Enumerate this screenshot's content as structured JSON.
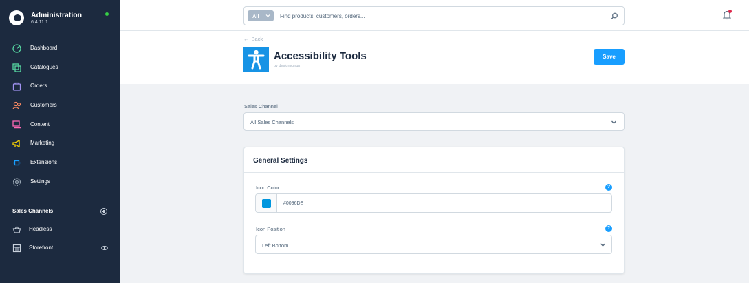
{
  "brand": {
    "title": "Administration",
    "version": "6.4.11.1"
  },
  "sidebar": {
    "items": [
      {
        "label": "Dashboard",
        "icon": "dashboard-icon",
        "color": "#57d9a3"
      },
      {
        "label": "Catalogues",
        "icon": "catalogues-icon",
        "color": "#57d9a3"
      },
      {
        "label": "Orders",
        "icon": "orders-icon",
        "color": "#a092f0"
      },
      {
        "label": "Customers",
        "icon": "customers-icon",
        "color": "#f88962"
      },
      {
        "label": "Content",
        "icon": "content-icon",
        "color": "#ff68b4"
      },
      {
        "label": "Marketing",
        "icon": "marketing-icon",
        "color": "#ffd700"
      },
      {
        "label": "Extensions",
        "icon": "extensions-icon",
        "color": "#189eff"
      },
      {
        "label": "Settings",
        "icon": "settings-icon",
        "color": "#9aa8b5"
      }
    ],
    "sales_channels": {
      "header": "Sales Channels",
      "items": [
        {
          "label": "Headless",
          "icon": "basket-icon"
        },
        {
          "label": "Storefront",
          "icon": "storefront-icon"
        }
      ]
    }
  },
  "search": {
    "type_label": "All",
    "placeholder": "Find products, customers, orders..."
  },
  "header": {
    "back_label": "Back",
    "plugin_title": "Accessibility Tools",
    "plugin_author": "by designvongs",
    "save_label": "Save"
  },
  "sales_channel": {
    "label": "Sales Channel",
    "value": "All Sales Channels"
  },
  "card": {
    "title": "General Settings",
    "icon_color": {
      "label": "Icon Color",
      "value": "#0096DE"
    },
    "icon_position": {
      "label": "Icon Position",
      "value": "Left Bottom"
    }
  },
  "colors": {
    "sidebar_bg": "#1c2a3f",
    "accent": "#189eff",
    "plugin_icon": "#1793e5"
  }
}
